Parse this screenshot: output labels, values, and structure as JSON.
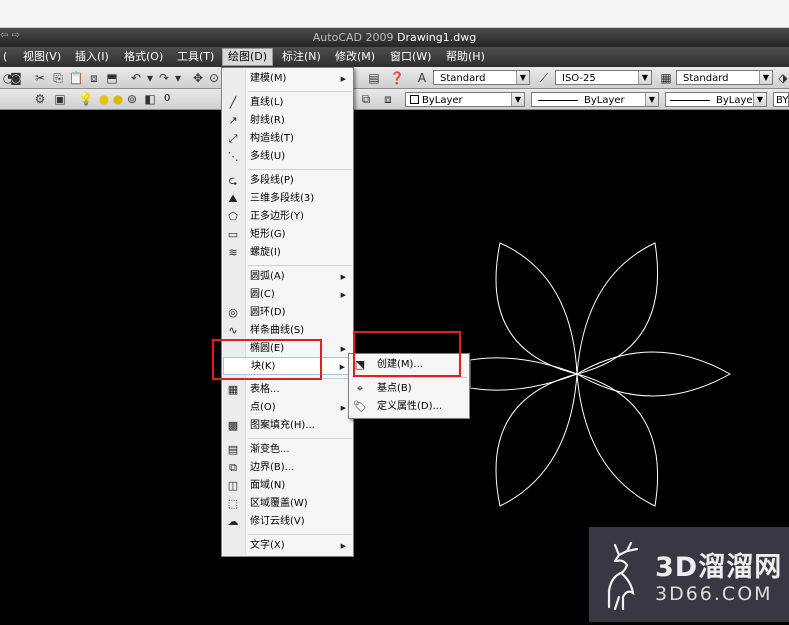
{
  "window": {
    "app_title": "AutoCAD 2009",
    "doc_title": "Drawing1.dwg",
    "nav_glyph": "⇦ ⇨"
  },
  "menubar": {
    "items": [
      {
        "label": "视图(V)"
      },
      {
        "label": "插入(I)"
      },
      {
        "label": "格式(O)"
      },
      {
        "label": "工具(T)"
      },
      {
        "label": "绘图(D)"
      },
      {
        "label": "标注(N)"
      },
      {
        "label": "修改(M)"
      },
      {
        "label": "窗口(W)"
      },
      {
        "label": "帮助(H)"
      }
    ],
    "active": "绘图(D)"
  },
  "toolbar1": {
    "text_style": "Standard",
    "dim_style": "ISO-25",
    "table_style": "Standard"
  },
  "toolbar2": {
    "layer_name": "0",
    "color": "ByLayer",
    "linetype": "ByLayer",
    "lineweight": "ByLayer",
    "plot_style": "BY"
  },
  "draw_menu": {
    "items": [
      {
        "label": "建模(M)",
        "icon": "modeling-icon",
        "glyph": "",
        "submenu": true
      },
      {
        "label": "直线(L)",
        "icon": "line-icon",
        "glyph": "╱"
      },
      {
        "label": "射线(R)",
        "icon": "ray-icon",
        "glyph": "↗"
      },
      {
        "label": "构造线(T)",
        "icon": "xline-icon",
        "glyph": "⤢"
      },
      {
        "label": "多线(U)",
        "icon": "multiline-icon",
        "glyph": "⋱"
      },
      {
        "label": "多段线(P)",
        "icon": "polyline-icon",
        "glyph": "⮎"
      },
      {
        "label": "三维多段线(3)",
        "icon": "3d-polyline-icon",
        "glyph": "⛰"
      },
      {
        "label": "正多边形(Y)",
        "icon": "polygon-icon",
        "glyph": "⬠"
      },
      {
        "label": "矩形(G)",
        "icon": "rectangle-icon",
        "glyph": "▭"
      },
      {
        "label": "螺旋(I)",
        "icon": "helix-icon",
        "glyph": "≋"
      },
      {
        "label": "圆弧(A)",
        "icon": "arc-icon",
        "glyph": "",
        "submenu": true
      },
      {
        "label": "圆(C)",
        "icon": "circle-icon",
        "glyph": "",
        "submenu": true
      },
      {
        "label": "圆环(D)",
        "icon": "donut-icon",
        "glyph": "◎"
      },
      {
        "label": "样条曲线(S)",
        "icon": "spline-icon",
        "glyph": "∿"
      },
      {
        "label": "椭圆(E)",
        "icon": "ellipse-icon",
        "glyph": "",
        "submenu": true
      },
      {
        "label": "块(K)",
        "icon": "block-icon",
        "glyph": "",
        "submenu": true
      },
      {
        "label": "表格...",
        "icon": "table-icon",
        "glyph": "▦"
      },
      {
        "label": "点(O)",
        "icon": "point-icon",
        "glyph": "",
        "submenu": true
      },
      {
        "label": "图案填充(H)...",
        "icon": "hatch-icon",
        "glyph": "▩"
      },
      {
        "label": "渐变色...",
        "icon": "gradient-icon",
        "glyph": "▤"
      },
      {
        "label": "边界(B)...",
        "icon": "boundary-icon",
        "glyph": "⧉"
      },
      {
        "label": "面域(N)",
        "icon": "region-icon",
        "glyph": "◫"
      },
      {
        "label": "区域覆盖(W)",
        "icon": "wipeout-icon",
        "glyph": "⬚"
      },
      {
        "label": "修订云线(V)",
        "icon": "revcloud-icon",
        "glyph": "☁"
      },
      {
        "label": "文字(X)",
        "icon": "text-icon",
        "glyph": "",
        "submenu": true
      }
    ]
  },
  "block_submenu": {
    "items": [
      {
        "label": "创建(M)...",
        "icon": "make-block-icon",
        "glyph": "⬔"
      },
      {
        "label": "基点(B)",
        "icon": "base-point-icon",
        "glyph": "⌖"
      },
      {
        "label": "定义属性(D)...",
        "icon": "define-attribute-icon",
        "glyph": "🏷"
      }
    ]
  },
  "watermark": {
    "cn": "3D溜溜网",
    "en": "3D66.COM"
  },
  "colors": {
    "menu_highlight": "#e21e1e",
    "drawing_lines": "#ffffff",
    "canvas": "#000000"
  }
}
